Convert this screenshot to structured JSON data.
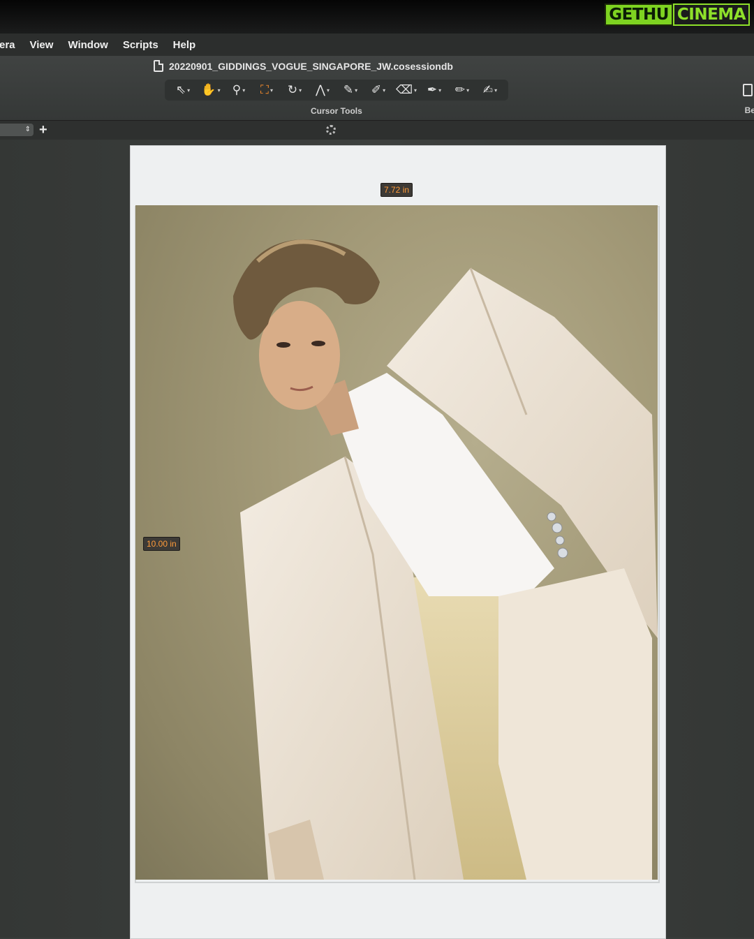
{
  "watermark": {
    "part1": "GETHU",
    "part2": "CINEMA"
  },
  "menubar": {
    "items": [
      "era",
      "View",
      "Window",
      "Scripts",
      "Help"
    ]
  },
  "document": {
    "title": "20220901_GIDDINGS_VOGUE_SINGAPORE_JW.cosessiondb"
  },
  "toolbar": {
    "label": "Cursor Tools",
    "side_label": "Bef",
    "tools": [
      {
        "icon": "select-arrow-icon",
        "glyph": "⇖",
        "active": false
      },
      {
        "icon": "hand-pan-icon",
        "glyph": "✋",
        "active": false
      },
      {
        "icon": "zoom-magnifier-icon",
        "glyph": "⚲",
        "active": false
      },
      {
        "icon": "crop-icon",
        "glyph": "⛶",
        "active": true
      },
      {
        "icon": "rotate-icon",
        "glyph": "↻",
        "active": false
      },
      {
        "icon": "keystone-icon",
        "glyph": "⋀",
        "active": false
      },
      {
        "icon": "brush-icon",
        "glyph": "✎",
        "active": false
      },
      {
        "icon": "mask-eraser-icon",
        "glyph": "✐",
        "active": false
      },
      {
        "icon": "eraser-icon",
        "glyph": "⌫",
        "active": false
      },
      {
        "icon": "color-picker-icon",
        "glyph": "✒",
        "active": false
      },
      {
        "icon": "annotate-pen-icon",
        "glyph": "✏",
        "active": false
      },
      {
        "icon": "draw-pencil-icon",
        "glyph": "✍",
        "active": false
      }
    ]
  },
  "viewer": {
    "width_label": "7.72 in",
    "height_label": "10.00 in"
  }
}
